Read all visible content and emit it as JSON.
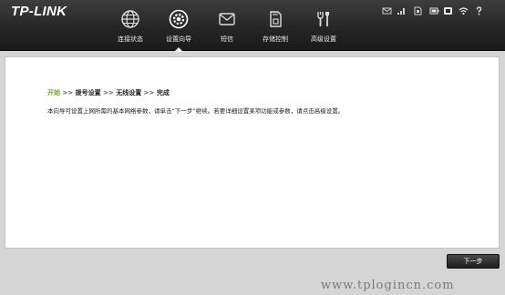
{
  "header": {
    "logo": "TP-LINK",
    "nav": [
      {
        "label": "连接状态",
        "icon": "globe-icon"
      },
      {
        "label": "设置向导",
        "icon": "gear-icon"
      },
      {
        "label": "短信",
        "icon": "envelope-icon"
      },
      {
        "label": "存储控制",
        "icon": "sd-card-icon"
      },
      {
        "label": "高级设置",
        "icon": "tools-icon"
      }
    ],
    "active_nav": "设置向导",
    "status_icons": [
      "mail-status-icon",
      "signal-strength-icon",
      "sim-status-icon",
      "battery-icon",
      "wifi-icon",
      "help-icon"
    ]
  },
  "wizard": {
    "breadcrumb": {
      "step1": "开始",
      "separator": ">>",
      "step2": "拨号设置",
      "step3": "无线设置",
      "step4": "完成"
    },
    "description": "本向导可设置上网所需的基本网络参数，请单击“下一步”继续。若要详细设置某项功能或参数，请点击高级设置。",
    "next_button": "下一步"
  },
  "watermark": "www.tplogincn.com",
  "colors": {
    "header_bg": "#262626",
    "active_step": "#7aa12a",
    "page_bg": "#d5d5d5",
    "panel_bg": "#ffffff",
    "button_bg": "#2b2b2b"
  }
}
